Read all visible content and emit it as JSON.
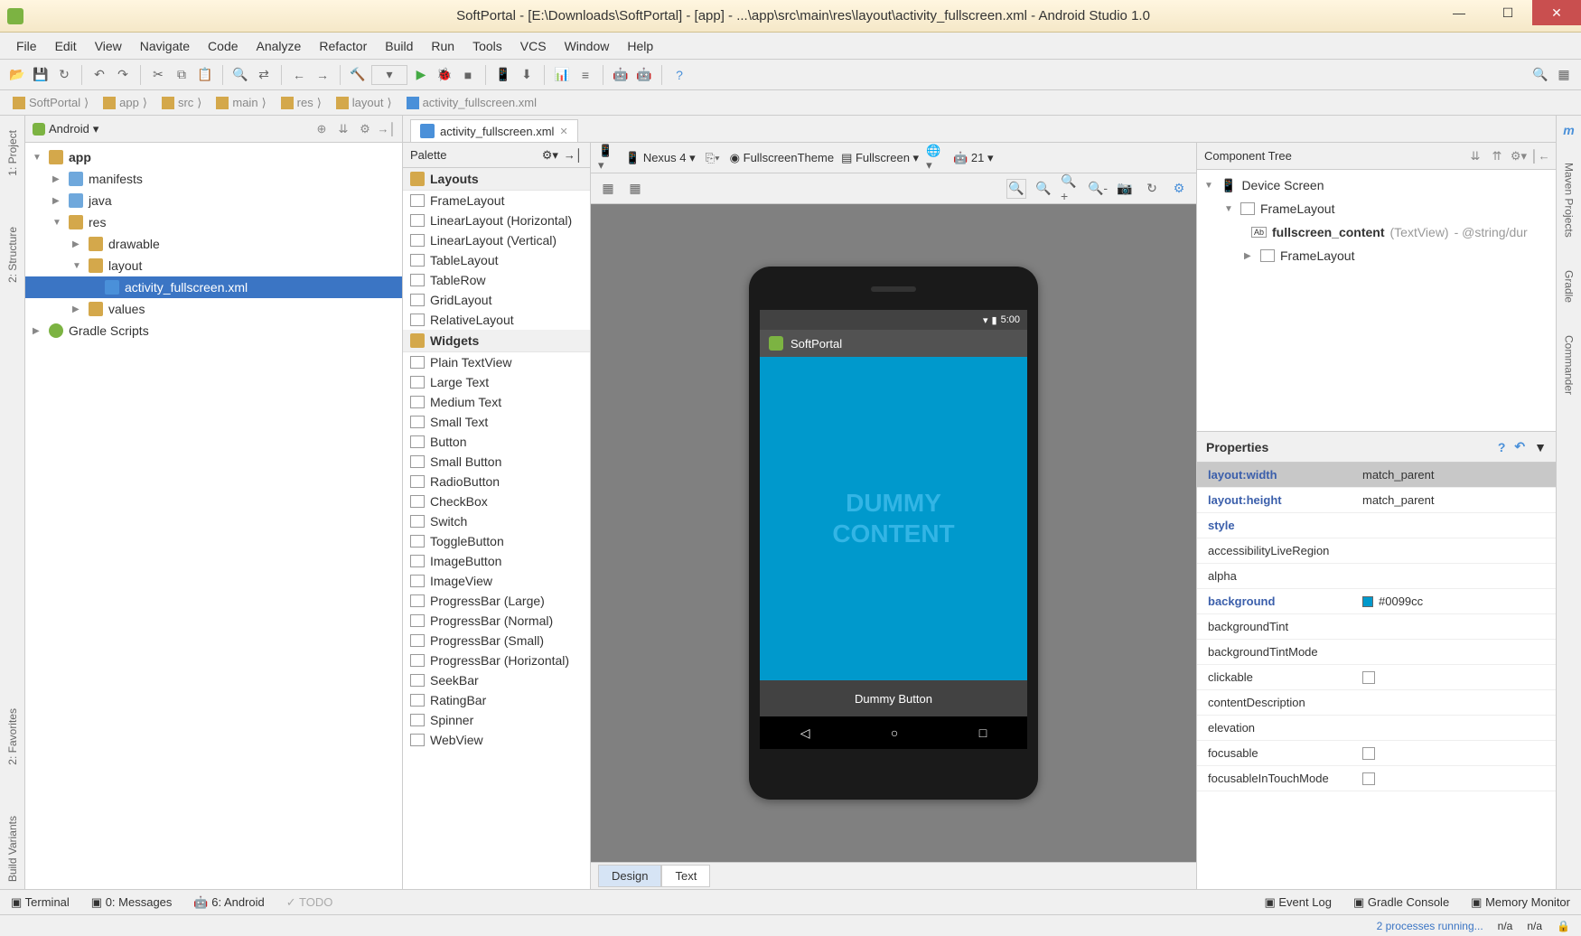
{
  "titlebar": "SoftPortal - [E:\\Downloads\\SoftPortal] - [app] - ...\\app\\src\\main\\res\\layout\\activity_fullscreen.xml - Android Studio 1.0",
  "menu": [
    "File",
    "Edit",
    "View",
    "Navigate",
    "Code",
    "Analyze",
    "Refactor",
    "Build",
    "Run",
    "Tools",
    "VCS",
    "Window",
    "Help"
  ],
  "breadcrumb": [
    "SoftPortal",
    "app",
    "src",
    "main",
    "res",
    "layout",
    "activity_fullscreen.xml"
  ],
  "project": {
    "header": "Android",
    "tree": {
      "app": "app",
      "manifests": "manifests",
      "java": "java",
      "res": "res",
      "drawable": "drawable",
      "layout": "layout",
      "activity": "activity_fullscreen.xml",
      "values": "values",
      "gradle": "Gradle Scripts"
    }
  },
  "editor_tab": "activity_fullscreen.xml",
  "palette": {
    "title": "Palette",
    "groups": {
      "layouts": "Layouts",
      "widgets": "Widgets"
    },
    "layouts": [
      "FrameLayout",
      "LinearLayout (Horizontal)",
      "LinearLayout (Vertical)",
      "TableLayout",
      "TableRow",
      "GridLayout",
      "RelativeLayout"
    ],
    "widgets": [
      "Plain TextView",
      "Large Text",
      "Medium Text",
      "Small Text",
      "Button",
      "Small Button",
      "RadioButton",
      "CheckBox",
      "Switch",
      "ToggleButton",
      "ImageButton",
      "ImageView",
      "ProgressBar (Large)",
      "ProgressBar (Normal)",
      "ProgressBar (Small)",
      "ProgressBar (Horizontal)",
      "SeekBar",
      "RatingBar",
      "Spinner",
      "WebView"
    ]
  },
  "design_toolbar": {
    "device": "Nexus 4",
    "theme": "FullscreenTheme",
    "variant": "Fullscreen",
    "api": "21"
  },
  "preview": {
    "time": "5:00",
    "app_name": "SoftPortal",
    "dummy_line1": "DUMMY",
    "dummy_line2": "CONTENT",
    "button": "Dummy Button"
  },
  "design_tabs": {
    "design": "Design",
    "text": "Text"
  },
  "component_tree": {
    "title": "Component Tree",
    "root": "Device Screen",
    "frame": "FrameLayout",
    "content": "fullscreen_content",
    "content_type": "(TextView)",
    "content_ref": "- @string/dur",
    "frame2": "FrameLayout"
  },
  "properties": {
    "title": "Properties",
    "rows": [
      {
        "name": "layout:width",
        "val": "match_parent",
        "bold": true,
        "selected": true
      },
      {
        "name": "layout:height",
        "val": "match_parent",
        "bold": true
      },
      {
        "name": "style",
        "val": "",
        "bold": true
      },
      {
        "name": "accessibilityLiveRegion",
        "val": ""
      },
      {
        "name": "alpha",
        "val": ""
      },
      {
        "name": "background",
        "val": "#0099cc",
        "bold": true,
        "color": true
      },
      {
        "name": "backgroundTint",
        "val": ""
      },
      {
        "name": "backgroundTintMode",
        "val": ""
      },
      {
        "name": "clickable",
        "val": "",
        "check": true
      },
      {
        "name": "contentDescription",
        "val": ""
      },
      {
        "name": "elevation",
        "val": ""
      },
      {
        "name": "focusable",
        "val": "",
        "check": true
      },
      {
        "name": "focusableInTouchMode",
        "val": "",
        "check": true
      }
    ]
  },
  "left_rail": [
    "1: Project",
    "2: Structure",
    "2: Favorites",
    "Build Variants"
  ],
  "right_rail": [
    "Maven Projects",
    "Gradle",
    "Commander"
  ],
  "bottom_tools": {
    "terminal": "Terminal",
    "messages": "0: Messages",
    "android": "6: Android",
    "todo": "TODO",
    "eventlog": "Event Log",
    "gradle": "Gradle Console",
    "memory": "Memory Monitor"
  },
  "status": {
    "processes": "2 processes running...",
    "na1": "n/a",
    "na2": "n/a"
  }
}
